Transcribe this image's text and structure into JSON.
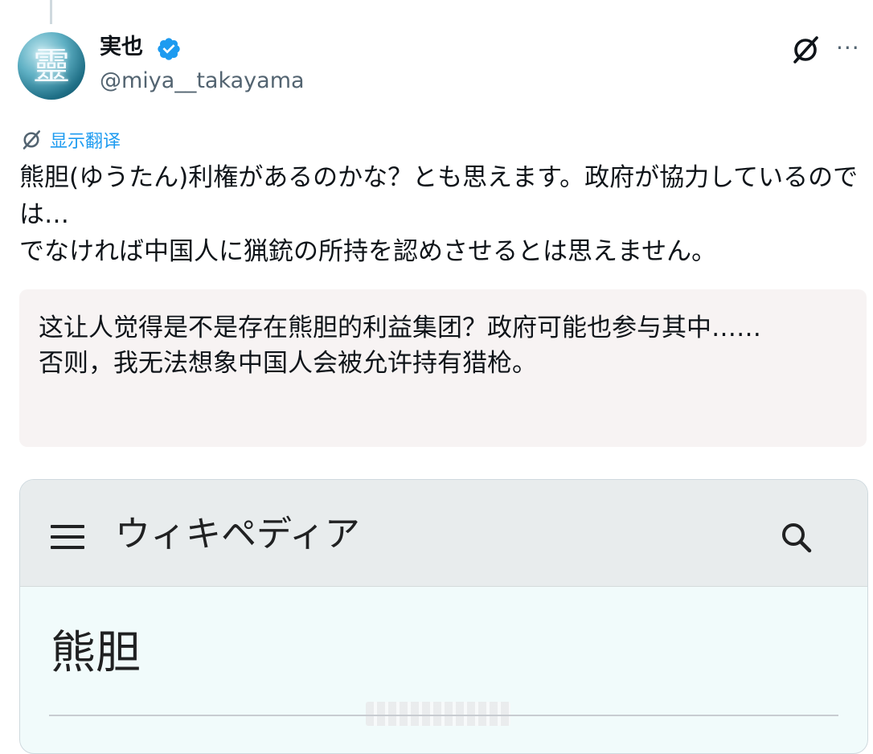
{
  "post": {
    "author": {
      "display_name": "実也",
      "handle": "@miya__takayama",
      "verified": true,
      "avatar_glyph": "靈"
    },
    "actions": {
      "grok_icon": "grok-icon",
      "more_label": "···"
    },
    "translate_link": "显示翻译",
    "text_lines": [
      "熊胆(ゆうたん)利権があるのかな？とも思えます。政府が協力しているのでは…",
      "でなければ中国人に猟銃の所持を認めさせるとは思えません。"
    ],
    "translation_lines": [
      "这让人觉得是不是存在熊胆的利益集团？政府可能也参与其中……",
      "否则，我无法想象中国人会被允许持有猎枪。"
    ],
    "media": {
      "site_name": "ウィキペディア",
      "article_title": "熊胆",
      "menu_icon": "hamburger-menu-icon",
      "search_icon": "search-icon"
    }
  },
  "colors": {
    "link_blue": "#1d9bf0",
    "verified_blue": "#1d9bf0",
    "secondary_text": "#536471",
    "translation_bg": "#f7f3f3"
  }
}
